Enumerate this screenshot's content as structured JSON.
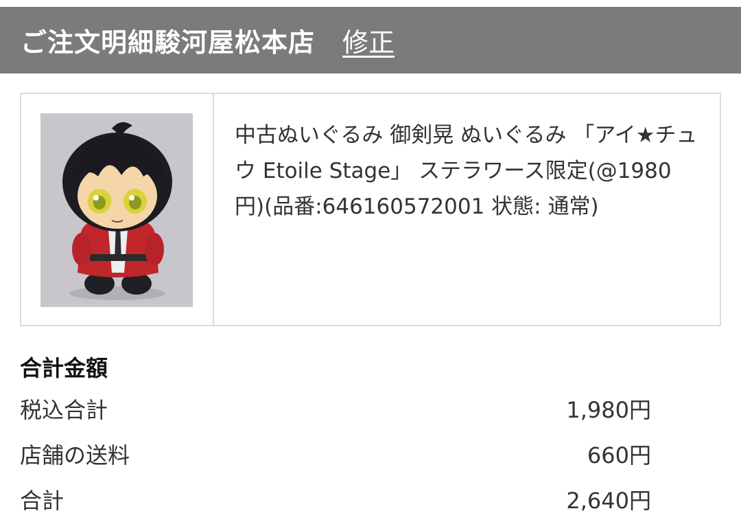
{
  "header": {
    "title": "ご注文明細駿河屋松本店",
    "edit_link": "修正"
  },
  "item": {
    "image_icon": "plush-doll-photo",
    "name": "中古ぬいぐるみ 御剣晃 ぬいぐるみ 「アイ★チュウ Etoile Stage」 ステラワース限定(@1980円)(品番:646160572001 状態: 通常)"
  },
  "totals": {
    "heading": "合計金額",
    "rows": [
      {
        "label": "税込合計",
        "value": "1,980円"
      },
      {
        "label": "店舗の送料",
        "value": "660円"
      },
      {
        "label": "合計",
        "value": "2,640円"
      }
    ]
  },
  "colors": {
    "header_bg": "#7b7b7b",
    "border": "#dcdcdc",
    "text": "#333333"
  }
}
